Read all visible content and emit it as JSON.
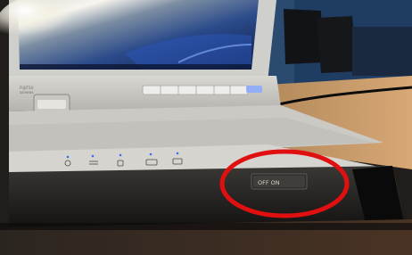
{
  "photo": {
    "subject": "laptop front edge",
    "brand_logo_text": "FUJITSU SIEMENS",
    "switch_label": "OFF ON",
    "highlight_color": "#e01010",
    "indicator_color": "#3a6cff",
    "icons": [
      "power-icon",
      "battery-icon",
      "hdd-icon",
      "wifi-icon",
      "bluetooth-icon"
    ]
  }
}
